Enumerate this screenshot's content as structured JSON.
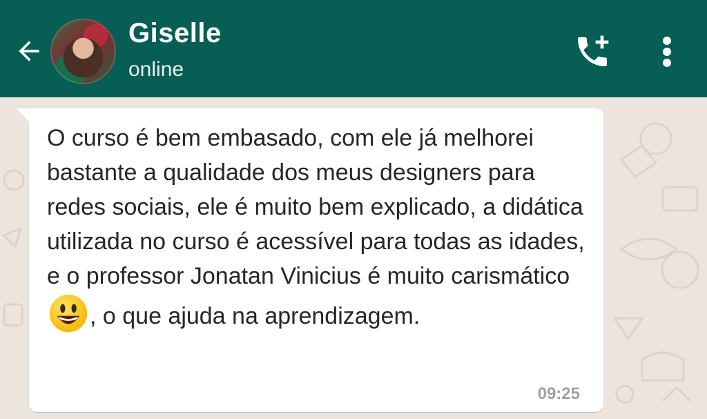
{
  "header": {
    "contact_name": "Giselle",
    "status": "online",
    "colors": {
      "bar": "#075e54",
      "chat_bg": "#ece5dd"
    },
    "icons": [
      "back-arrow-icon",
      "avatar",
      "add-call-icon",
      "more-vertical-icon"
    ]
  },
  "message": {
    "part1": "O curso é bem embasado, com ele já melhorei bastante a qualidade dos meus designers para redes sociais, ele é muito bem explicado, a didática utilizada no curso é acessível para todas as idades, e o professor Jonatan Vinicius é muito carismático",
    "emoji": "grinning-face",
    "part2": ", o que ajuda na aprendizagem.",
    "time": "09:25"
  }
}
